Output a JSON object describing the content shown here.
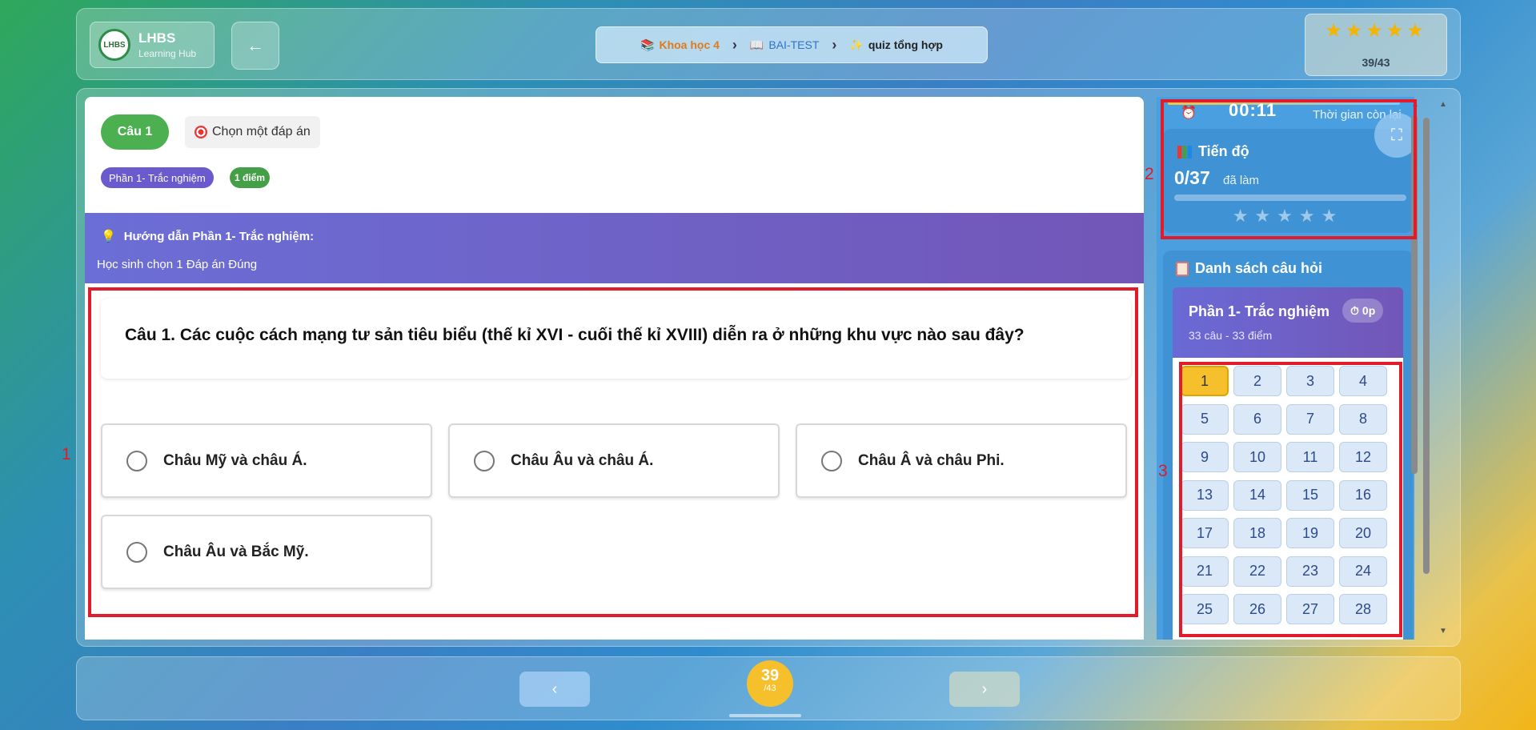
{
  "header": {
    "logo_text": "LHBS",
    "logo_title": "LHBS",
    "logo_subtitle": "Learning Hub",
    "back_icon": "arrow-left-icon",
    "breadcrumb": [
      "Khoa học 4",
      "BAI-TEST",
      "quiz tổng hợp"
    ],
    "stars": "★★★★★",
    "progress_count": "39/43"
  },
  "question": {
    "number_label": "Câu 1",
    "mode_label": "Chọn một đáp án",
    "part_badge": "Phần 1- Trắc nghiệm",
    "points_badge": "1 điểm",
    "guide_title": "Hướng dẫn Phần 1- Trắc nghiệm:",
    "guide_text": "Học sinh chọn 1 Đáp án Đúng",
    "text": "Câu 1. Các cuộc cách mạng tư sản tiêu biểu (thế kỉ XVI - cuối thế kỉ XVIII) diễn ra ở những khu vực nào sau đây?",
    "options": [
      "Châu Mỹ và châu Á.",
      "Châu Âu và châu Á.",
      "Châu Â và châu Phi.",
      "Châu Âu và Bắc Mỹ."
    ]
  },
  "sidebar": {
    "timer": "00:11",
    "timer_label": "Thời gian còn lại",
    "progress_title": "Tiến độ",
    "progress_value": "0/37",
    "progress_done_label": "đã làm",
    "progress_fraction": 0,
    "progress_stars": "★★★★★",
    "list_title": "Danh sách câu hỏi",
    "section_name": "Phần 1- Trắc nghiệm",
    "section_sub": "33 câu - 33 điểm",
    "section_time": "0p",
    "active_question": 1,
    "questions": [
      "1",
      "2",
      "3",
      "4",
      "5",
      "6",
      "7",
      "8",
      "9",
      "10",
      "11",
      "12",
      "13",
      "14",
      "15",
      "16",
      "17",
      "18",
      "19",
      "20",
      "21",
      "22",
      "23",
      "24",
      "25",
      "26",
      "27",
      "28"
    ]
  },
  "annotations": {
    "label_1": "1",
    "label_2": "2",
    "label_3": "3"
  },
  "footer": {
    "prev_label": "‹",
    "next_label": "›",
    "current": "39",
    "total": "/43"
  }
}
